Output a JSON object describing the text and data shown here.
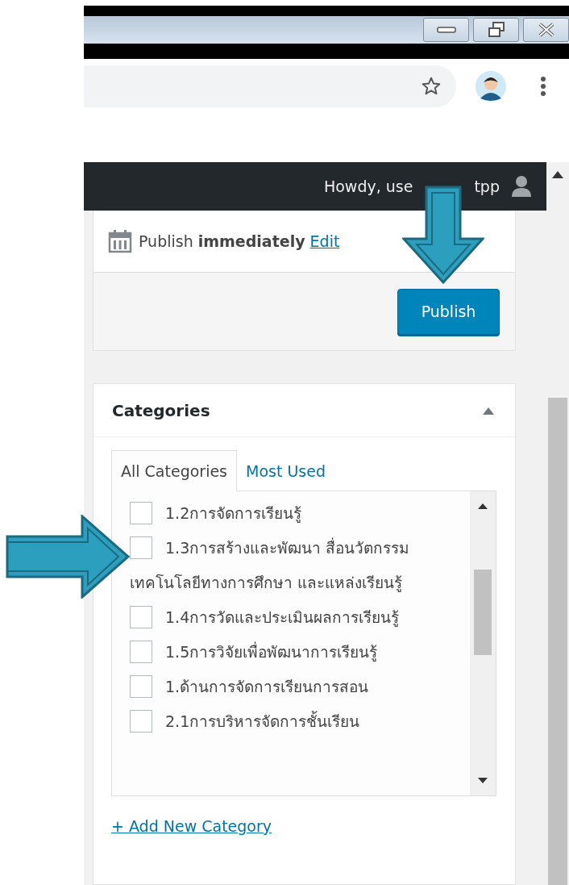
{
  "admin_bar": {
    "greeting_start": "Howdy, use",
    "greeting_end": "tpp"
  },
  "publish_box": {
    "status": "Publish **immediately**",
    "edit_link": "Edit",
    "publish_button": "Publish"
  },
  "categories": {
    "title": "Categories",
    "tabs": [
      {
        "label": "All Categories",
        "selected": true
      },
      {
        "label": "Most Used",
        "selected": false
      }
    ],
    "items": [
      {
        "label": "1.2การจัดการเรียนรู้",
        "checked": false
      },
      {
        "label": "1.3การสร้างและพัฒนา สื่อนวัตกรรม เทคโนโลยีทางการศึกษา และแหล่งเรียนรู้",
        "checked": false
      },
      {
        "label": "1.4การวัดและประเมินผลการเรียนรู้",
        "checked": false
      },
      {
        "label": "1.5การวิจัยเพื่อพัฒนาการเรียนรู้",
        "checked": false
      },
      {
        "label": "1.ด้านการจัดการเรียนการสอน",
        "checked": false
      },
      {
        "label": "2.1การบริหารจัดการชั้นเรียน",
        "checked": false
      }
    ],
    "add_link": "+ Add New Category"
  }
}
